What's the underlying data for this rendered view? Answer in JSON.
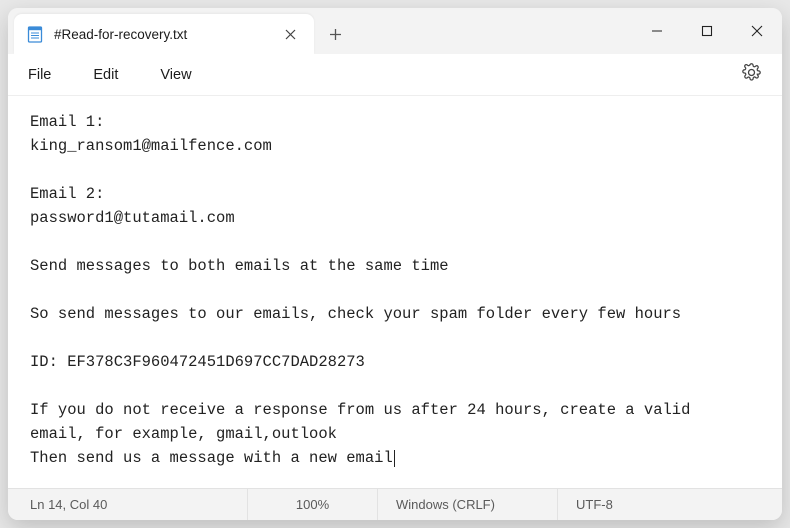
{
  "tab": {
    "title": "#Read-for-recovery.txt"
  },
  "menus": {
    "file": "File",
    "edit": "Edit",
    "view": "View"
  },
  "content": {
    "lines": [
      "Email 1:",
      "king_ransom1@mailfence.com",
      "",
      "Email 2:",
      "password1@tutamail.com",
      "",
      "Send messages to both emails at the same time",
      "",
      "So send messages to our emails, check your spam folder every few hours",
      "",
      "ID: EF378C3F960472451D697CC7DAD28273",
      "",
      "If you do not receive a response from us after 24 hours, create a valid",
      "email, for example, gmail,outlook",
      "Then send us a message with a new email"
    ]
  },
  "status": {
    "position": "Ln 14, Col 40",
    "zoom": "100%",
    "eol": "Windows (CRLF)",
    "encoding": "UTF-8"
  }
}
